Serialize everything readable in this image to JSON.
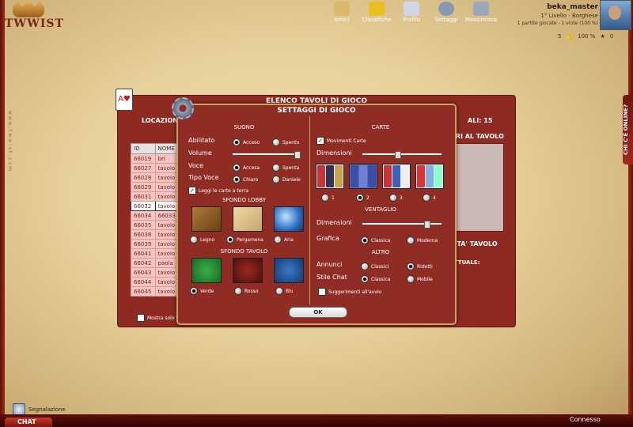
{
  "logo": {
    "text": "TWWIST"
  },
  "left_strip": "www.twwist.com",
  "topbar": [
    {
      "label": "Amici",
      "color": "#d9b96a"
    },
    {
      "label": "Classifiche",
      "color": "#e8c020"
    },
    {
      "label": "Profilo",
      "color": "#cfd6e4"
    },
    {
      "label": "Settaggi",
      "color": "#8b96b0"
    },
    {
      "label": "Massimizza",
      "color": "#9aa8bd"
    }
  ],
  "user": {
    "name": "beka_master",
    "level": "1° Livello - Borghese",
    "stats": "1 partite giocate - 1 vinte (100 %)",
    "coins": "5",
    "percent": "100 %",
    "stars": "0"
  },
  "chi_online": "CHI C'È ONLINE?",
  "back_panel": {
    "title": "ELENCO TAVOLI DI GIOCO",
    "location_label": "LOCAZIONE:",
    "right_label": "ALI:  15",
    "right_label2": "ORI AL TAVOLO",
    "right_label3": "IETA' TAVOLO",
    "right_label4": "ATTUALE:",
    "table_headers": [
      "ID",
      "NOME"
    ],
    "rows": [
      [
        "66019",
        "bri"
      ],
      [
        "66027",
        "tavolo"
      ],
      [
        "66028",
        "tavolo"
      ],
      [
        "66029",
        "tavolo"
      ],
      [
        "66031",
        "tavolo"
      ],
      [
        "66032",
        "tavolo"
      ],
      [
        "66034",
        "66033"
      ],
      [
        "66035",
        "tavolo"
      ],
      [
        "66038",
        "tavolo"
      ],
      [
        "66039",
        "tavolo"
      ],
      [
        "66041",
        "tavolo"
      ],
      [
        "66042",
        "paola"
      ],
      [
        "66043",
        "tavolo"
      ],
      [
        "66044",
        "tavolo"
      ],
      [
        "66045",
        "tavolo"
      ]
    ],
    "selected_row": 5,
    "checkbox_label": "Mostra solo ta"
  },
  "dialog": {
    "title": "SETTAGGI DI GIOCO",
    "sound": {
      "section": "SUONO",
      "abilitato_label": "Abilitato",
      "abilitato_on": "Acceso",
      "abilitato_off": "Spento",
      "volume_label": "Volume",
      "volume_level": 1.0,
      "voce_label": "Voce",
      "voce_on": "Accesa",
      "voce_off": "Spenta",
      "tipo_voce_label": "Tipo Voce",
      "tipo_voce_a": "Chiara",
      "tipo_voce_b": "Daniele",
      "leggi_label": "Leggi le carte a terra"
    },
    "sfondo_lobby": {
      "section": "SFONDO LOBBY",
      "options": [
        "Legno",
        "Pergamena",
        "Aria"
      ],
      "selected": 1
    },
    "sfondo_tavolo": {
      "section": "SFONDO TAVOLO",
      "options": [
        "Verde",
        "Rosso",
        "Blu"
      ],
      "selected": 0
    },
    "carte": {
      "section": "CARTE",
      "movimenti_label": "Movimenti Carte",
      "dimensioni_label": "Dimensioni",
      "dimensioni_level": 0.45,
      "decks": [
        "1",
        "2",
        "3",
        "4"
      ],
      "selected_deck": 1
    },
    "ventaglio": {
      "section": "VENTAGLIO",
      "dimensioni_label": "Dimensioni",
      "dimensioni_level": 0.85,
      "grafica_label": "Grafica",
      "grafica_a": "Classica",
      "grafica_b": "Moderna"
    },
    "altro": {
      "section": "ALTRO",
      "annunci_label": "Annunci",
      "annunci_a": "Classici",
      "annunci_b": "Ridotti",
      "stile_chat_label": "Stile Chat",
      "stile_chat_a": "Classica",
      "stile_chat_b": "Mobile",
      "suggerimenti_label": "Suggerimenti all'avvio"
    },
    "ok_label": "OK"
  },
  "bottom": {
    "segnalazione": "Segnalazione",
    "chat": "CHAT",
    "connesso": "Connesso"
  }
}
